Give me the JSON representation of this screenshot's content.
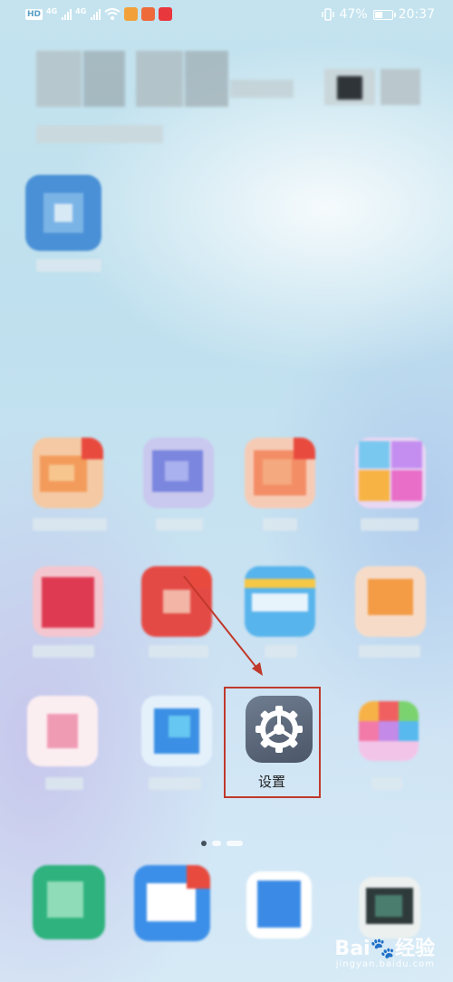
{
  "status_bar": {
    "hd_label": "HD",
    "net_1": "4G",
    "net_2": "4G",
    "battery_percent": "47%",
    "time": "20:37"
  },
  "highlighted_app": {
    "label": "设置",
    "icon": "gear-icon",
    "highlight_color": "#c0392b"
  },
  "annotation": {
    "arrow_color": "#c0392b"
  },
  "watermark": {
    "brand": "Bai",
    "brand_suffix": "经验",
    "url": "jingyan.baidu.com"
  }
}
